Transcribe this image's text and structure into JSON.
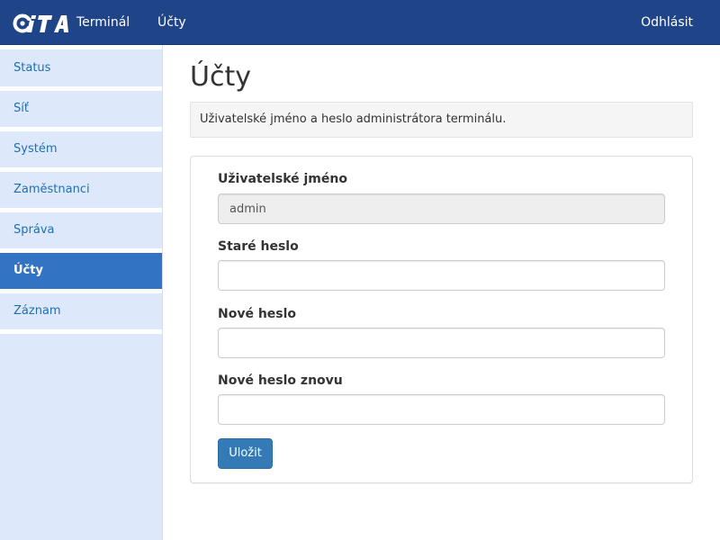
{
  "navbar": {
    "brand_icon": "cita-logo",
    "terminal_label": "Terminál",
    "accounts_label": "Účty",
    "logout_label": "Odhlásit",
    "background_color": "#1f4588"
  },
  "sidebar": {
    "items": [
      {
        "label": "Status",
        "active": false
      },
      {
        "label": "Síť",
        "active": false
      },
      {
        "label": "Systém",
        "active": false
      },
      {
        "label": "Zaměstnanci",
        "active": false
      },
      {
        "label": "Správa",
        "active": false
      },
      {
        "label": "Účty",
        "active": true
      },
      {
        "label": "Záznam",
        "active": false
      }
    ],
    "active_color": "#3373c4",
    "item_color": "#dde9fb"
  },
  "main": {
    "title": "Účty",
    "info_text": "Uživatelské jméno a heslo administrátora terminálu.",
    "form": {
      "username_label": "Uživatelské jméno",
      "username_value": "admin",
      "old_password_label": "Staré heslo",
      "new_password_label": "Nové heslo",
      "new_password_again_label": "Nové heslo znovu",
      "save_label": "Uložit",
      "save_color": "#337ab7"
    }
  }
}
